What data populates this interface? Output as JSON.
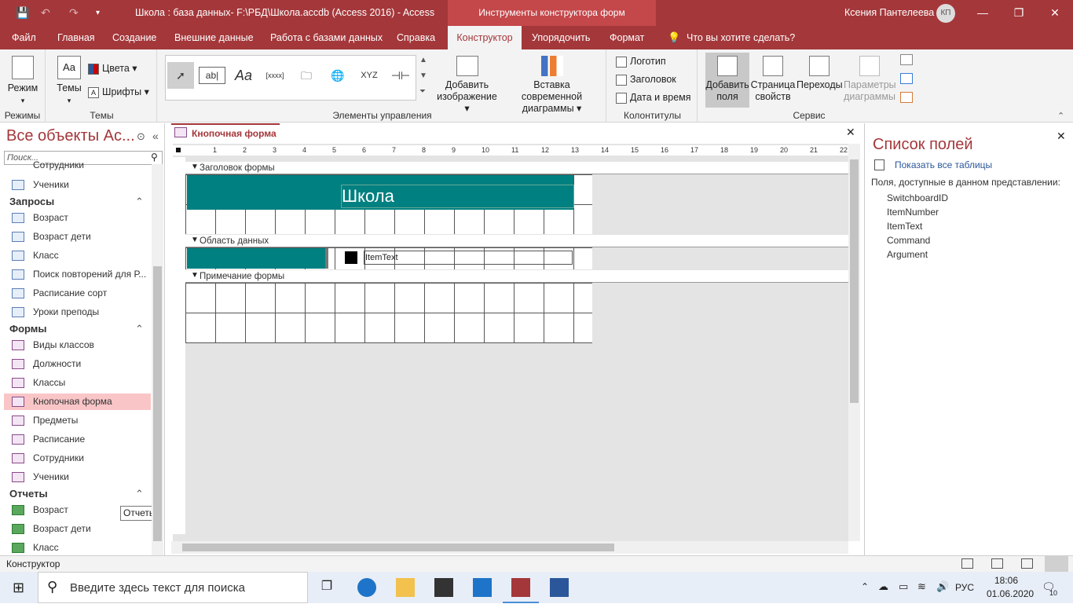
{
  "titlebar": {
    "title": "Школа : база данных- F:\\РБД\\Школа.accdb (Access 2016)  -  Access",
    "context": "Инструменты конструктора форм",
    "user": "Ксения Пантелеева",
    "avatar": "КП",
    "min": "—",
    "restore": "❐",
    "close": "✕"
  },
  "tabs": [
    "Файл",
    "Главная",
    "Создание",
    "Внешние данные",
    "Работа с базами данных",
    "Справка",
    "Конструктор",
    "Упорядочить",
    "Формат",
    "Что вы хотите сделать?"
  ],
  "ribbon": {
    "mode_label": "Режим",
    "modes_group": "Режимы",
    "themes_label": "Темы",
    "colors_label": "Цвета",
    "fonts_label": "Шрифты",
    "themes_group": "Темы",
    "controls_group": "Элементы управления",
    "add_image": "Добавить изображение",
    "insert_chart": "Вставка современной диаграммы",
    "logo": "Логотип",
    "heading": "Заголовок",
    "datetime": "Дата и время",
    "hf_group": "Колонтитулы",
    "add_fields": "Добавить поля",
    "property_sheet": "Страница свойств",
    "transitions": "Переходы",
    "chart_params": "Параметры диаграммы",
    "service_group": "Сервис"
  },
  "nav": {
    "header": "Все объекты Ac...",
    "search_placeholder": "Поиск...",
    "top_items": [
      "Сотрудники",
      "Ученики"
    ],
    "queries_header": "Запросы",
    "queries": [
      "Возраст",
      "Возраст дети",
      "Класс",
      "Поиск повторений для Р...",
      "Расписание сорт",
      "Уроки преподы"
    ],
    "forms_header": "Формы",
    "forms": [
      "Виды классов",
      "Должности",
      "Классы",
      "Кнопочная форма",
      "Предметы",
      "Расписание",
      "Сотрудники",
      "Ученики"
    ],
    "reports_header": "Отчеты",
    "reports": [
      "Возраст",
      "Возраст дети",
      "Класс"
    ],
    "tooltip": "Отчеты"
  },
  "doc": {
    "tab": "Кнопочная форма",
    "header_section": "Заголовок формы",
    "title_text": "Школа",
    "detail_section": "Область данных",
    "item_label": "ItemText",
    "footer_section": "Примечание формы",
    "ruler": [
      "1",
      "2",
      "3",
      "4",
      "5",
      "6",
      "7",
      "8",
      "9",
      "10",
      "11",
      "12",
      "13",
      "14",
      "15",
      "16",
      "17",
      "18",
      "19",
      "20",
      "21",
      "22"
    ]
  },
  "fieldlist": {
    "header": "Список полей",
    "show_all": "Показать все таблицы",
    "available": "Поля, доступные в данном представлении:",
    "fields": [
      "SwitchboardID",
      "ItemNumber",
      "ItemText",
      "Command",
      "Argument"
    ]
  },
  "status": {
    "text": "Конструктор"
  },
  "taskbar": {
    "search": "Введите здесь текст для поиска",
    "lang": "РУС",
    "time": "18:06",
    "date": "01.06.2020",
    "notif": "10"
  },
  "colors": {
    "accent": "#a4373a",
    "teal": "#008080",
    "selected": "#f9c5c7"
  }
}
